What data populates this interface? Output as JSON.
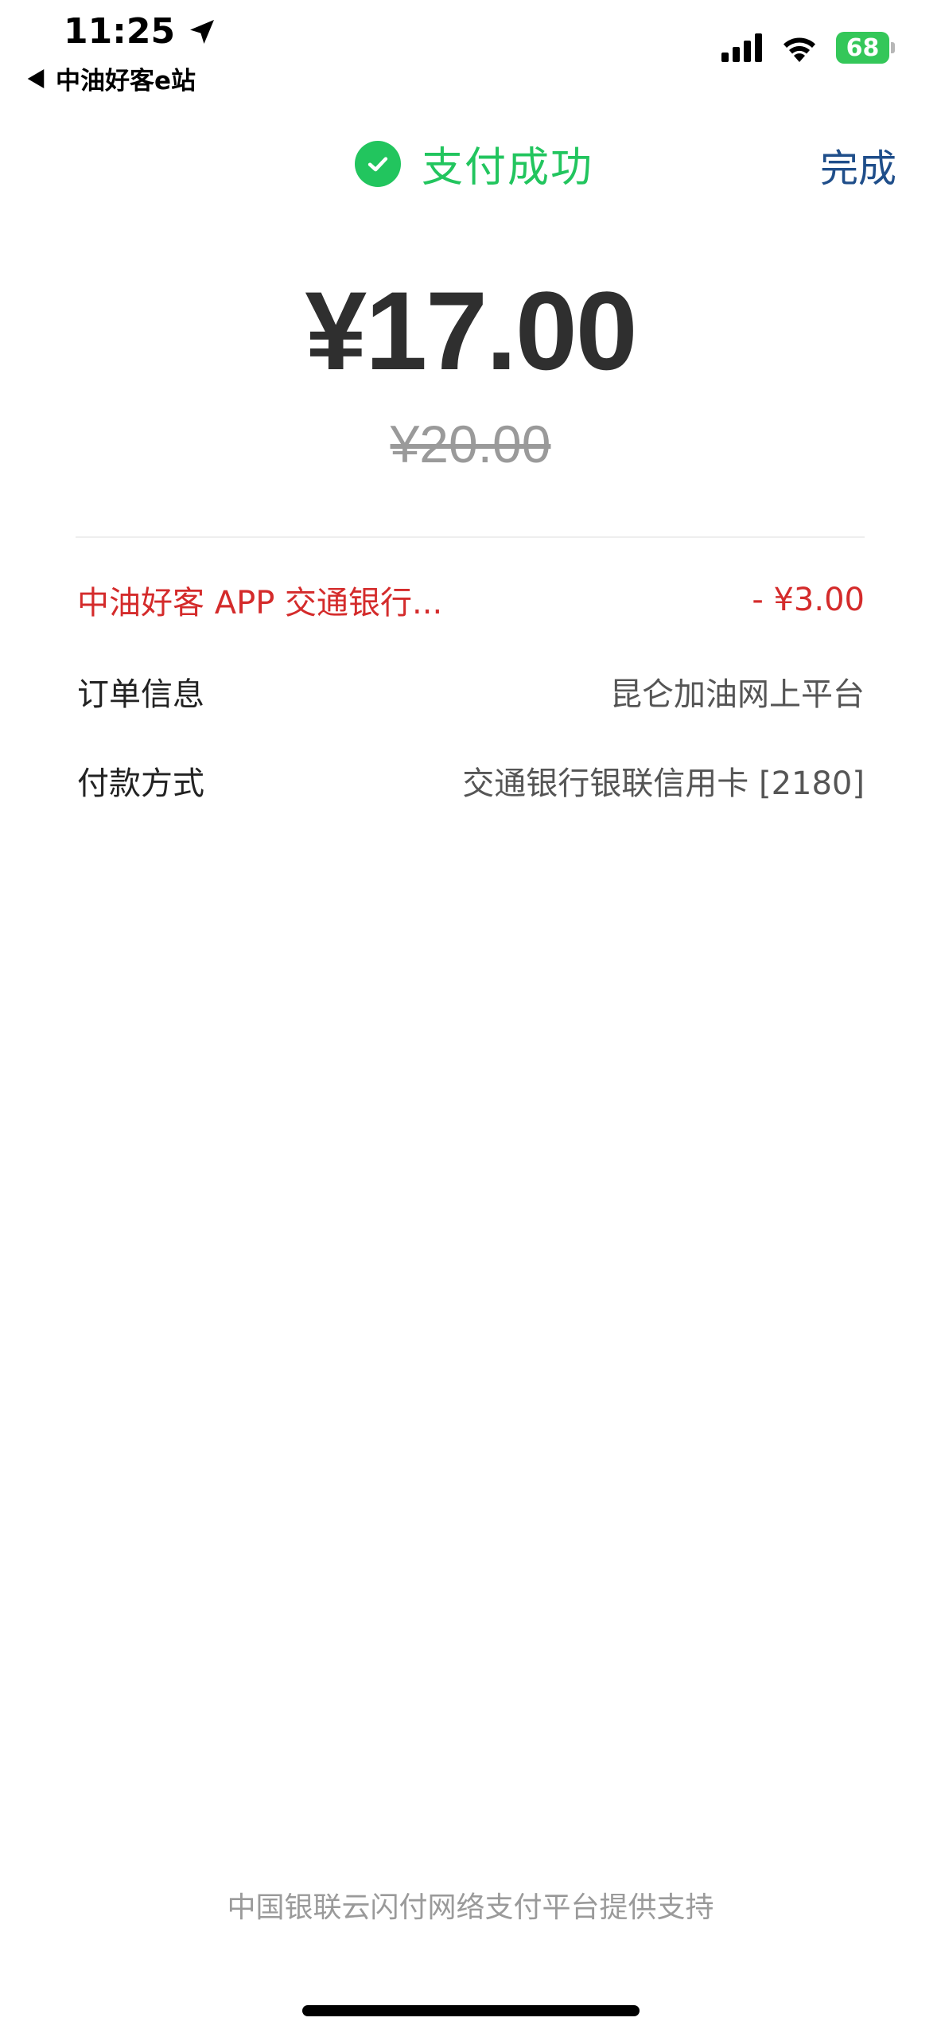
{
  "status_bar": {
    "time": "11:25",
    "back_app": "中油好客e站",
    "battery_level": "68",
    "battery_color": "#34c759"
  },
  "header": {
    "status_text": "支付成功",
    "done_label": "完成",
    "accent_color": "#22c55e"
  },
  "payment": {
    "amount": "¥17.00",
    "original_amount": "¥20.00"
  },
  "details": {
    "discount": {
      "label": "中油好客 APP 交通银行...",
      "value": "- ¥3.00"
    },
    "order": {
      "label": "订单信息",
      "value": "昆仑加油网上平台"
    },
    "payment_method": {
      "label": "付款方式",
      "value": "交通银行银联信用卡 [2180]"
    }
  },
  "footer": {
    "text": "中国银联云闪付网络支付平台提供支持"
  }
}
